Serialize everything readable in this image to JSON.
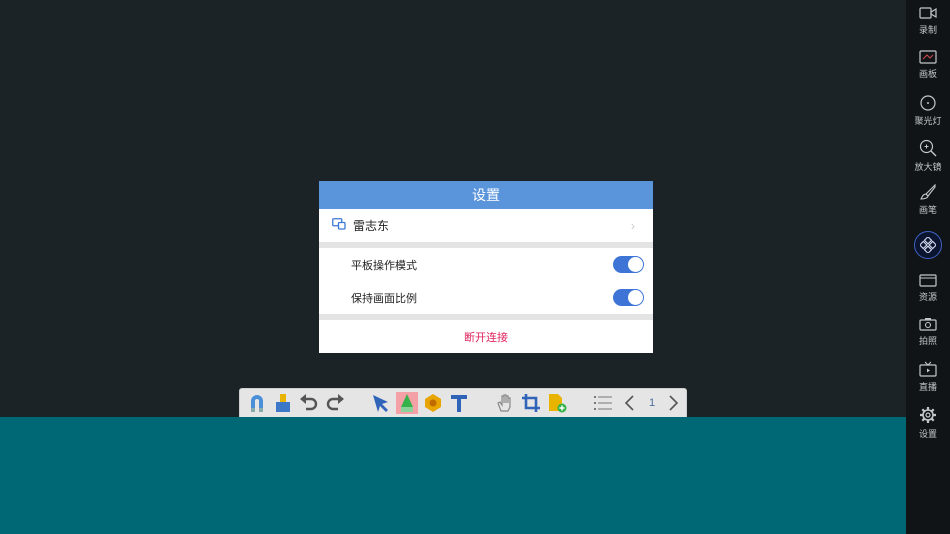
{
  "dialog": {
    "title": "设置",
    "user_name": "雷志东",
    "chevron": "›",
    "settings": [
      {
        "label": "平板操作模式",
        "enabled": true
      },
      {
        "label": "保持画面比例",
        "enabled": true
      }
    ],
    "disconnect_label": "断开连接"
  },
  "sidebar": {
    "items": [
      {
        "label": "录制",
        "icon": "video-camera-icon"
      },
      {
        "label": "画板",
        "icon": "whiteboard-icon"
      },
      {
        "label": "聚光灯",
        "icon": "spotlight-icon"
      },
      {
        "label": "放大镜",
        "icon": "magnifier-icon"
      },
      {
        "label": "画笔",
        "icon": "brush-icon"
      },
      {
        "label": "资源",
        "icon": "folder-icon"
      },
      {
        "label": "拍照",
        "icon": "camera-icon"
      },
      {
        "label": "直播",
        "icon": "tv-icon"
      },
      {
        "label": "设置",
        "icon": "gear-icon"
      }
    ]
  },
  "toolbar": {
    "page_number": "1"
  },
  "colors": {
    "header": "#5a94db",
    "teal_area": "#006874",
    "stage": "#1b2326",
    "toggle_on": "#3d74d6",
    "disconnect": "#e0245e"
  }
}
